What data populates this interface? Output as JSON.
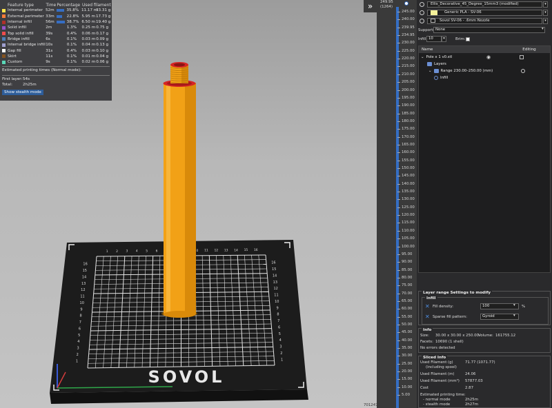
{
  "legend": {
    "headers": [
      "Feature type",
      "Time",
      "Percentage",
      "Used filament"
    ],
    "rows": [
      {
        "name": "Internal perimeter",
        "time": "52m",
        "pct": "35.8%",
        "m": "11.17 m",
        "g": "33.31 g",
        "color": "#ffe54c",
        "bar": 0.9
      },
      {
        "name": "External perimeter",
        "time": "33m",
        "pct": "22.8%",
        "m": "5.95 m",
        "g": "17.73 g",
        "color": "#ff7d38",
        "bar": 0.6
      },
      {
        "name": "Internal infill",
        "time": "56m",
        "pct": "38.7%",
        "m": "6.50 m",
        "g": "19.40 g",
        "color": "#b03029",
        "bar": 0.95
      },
      {
        "name": "Solid infill",
        "time": "2m",
        "pct": "1.3%",
        "m": "0.25 m",
        "g": "0.75 g",
        "color": "#9654cc",
        "bar": 0
      },
      {
        "name": "Top solid infill",
        "time": "39s",
        "pct": "0.4%",
        "m": "0.06 m",
        "g": "0.17 g",
        "color": "#f14c4c",
        "bar": 0
      },
      {
        "name": "Bridge infill",
        "time": "6s",
        "pct": "0.1%",
        "m": "0.03 m",
        "g": "0.09 g",
        "color": "#4d80ba",
        "bar": 0
      },
      {
        "name": "Internal bridge infill",
        "time": "10s",
        "pct": "0.1%",
        "m": "0.04 m",
        "g": "0.13 g",
        "color": "#a0a0d0",
        "bar": 0
      },
      {
        "name": "Gap fill",
        "time": "31s",
        "pct": "0.4%",
        "m": "0.03 m",
        "g": "0.10 g",
        "color": "#ffffff",
        "bar": 0
      },
      {
        "name": "Skirt",
        "time": "11s",
        "pct": "0.1%",
        "m": "0.01 m",
        "g": "0.04 g",
        "color": "#845321",
        "bar": 0
      },
      {
        "name": "Custom",
        "time": "9s",
        "pct": "0.1%",
        "m": "0.02 m",
        "g": "0.06 g",
        "color": "#5ad8b8",
        "bar": 0
      }
    ],
    "est_title": "Estimated printing times (Normal mode):",
    "first_layer_k": "First layer:",
    "first_layer_v": "54s",
    "total_k": "Total:",
    "total_v": "2h25m",
    "stealth_btn": "Show stealth mode"
  },
  "slider": {
    "top_value": "249.95",
    "top_layer": "(1264)",
    "ticks": [
      "245.00",
      "240.00",
      "239.95",
      "234.95",
      "230.00",
      "225.00",
      "220.00",
      "215.00",
      "210.00",
      "205.00",
      "200.00",
      "195.00",
      "190.00",
      "185.00",
      "180.00",
      "175.00",
      "170.00",
      "165.00",
      "160.00",
      "155.00",
      "150.00",
      "145.00",
      "140.00",
      "135.00",
      "130.00",
      "125.00",
      "120.00",
      "115.00",
      "110.00",
      "105.00",
      "100.00",
      "95.00",
      "90.00",
      "85.00",
      "80.00",
      "75.00",
      "70.00",
      "65.00",
      "60.00",
      "55.00",
      "50.00",
      "45.00",
      "40.00",
      "35.00",
      "30.00",
      "25.00",
      "20.00",
      "15.00",
      "10.00",
      "5.00"
    ],
    "bottom_count": "701247"
  },
  "collapse_icon": "double-chevron-right",
  "presets": {
    "print": "Ellis_Decorative_45_Degree_15mm3 (modified)",
    "filament": "Generic PLA - SV-06",
    "printer": "Sovol SV-06 - .6mm Nozzle"
  },
  "supports": {
    "label": "Supports:",
    "value": "None"
  },
  "infill": {
    "label": "Infill:",
    "value": "10",
    "brim_label": "Brim:"
  },
  "objects": {
    "col_name": "Name",
    "col_editing": "Editing",
    "items": [
      "Pole x 1 v0.stl",
      "Layers",
      "Range 230.00–250.00 (mm)",
      "Infill"
    ]
  },
  "layer_range": {
    "title": "Layer range Settings to modify",
    "sub": "Infill",
    "fill_density_label": "Fill density:",
    "fill_density_value": "100",
    "fill_density_unit": "%",
    "pattern_label": "Sparse fill pattern:",
    "pattern_value": "Gyroid"
  },
  "info": {
    "title": "Info",
    "size_k": "Size:",
    "size_v": "30.00 x 30.00 x 250.00",
    "volume_k": "Volume:",
    "volume_v": "161755.12",
    "facets_k": "Facets:",
    "facets_v": "10690 (1 shell)",
    "errors": "No errors detected"
  },
  "sliced": {
    "title": "Sliced Info",
    "filament_g_k": "Used Filament (g)",
    "filament_g_sub": "(including spool)",
    "filament_g_v": "71.77 (1071.77)",
    "filament_m_k": "Used Filament (m)",
    "filament_m_v": "24.06",
    "filament_mm3_k": "Used Filament (mm³)",
    "filament_mm3_v": "57877.03",
    "cost_k": "Cost",
    "cost_v": "2.87",
    "est_k": "Estimated printing time:",
    "normal_k": "- normal mode",
    "normal_v": "2h25m",
    "stealth_k": "- stealth mode",
    "stealth_v": "2h27m"
  },
  "bed": {
    "brand": "SOVOL",
    "labels": [
      "16",
      "15",
      "14",
      "13",
      "12",
      "11",
      "10",
      "9",
      "8",
      "7",
      "6",
      "5",
      "4",
      "3",
      "2",
      "1"
    ]
  },
  "colors": {
    "accent": "#356ec4",
    "model": "#f2a116",
    "model_shade": "#d98a0a",
    "red_cap": "#d62424"
  }
}
